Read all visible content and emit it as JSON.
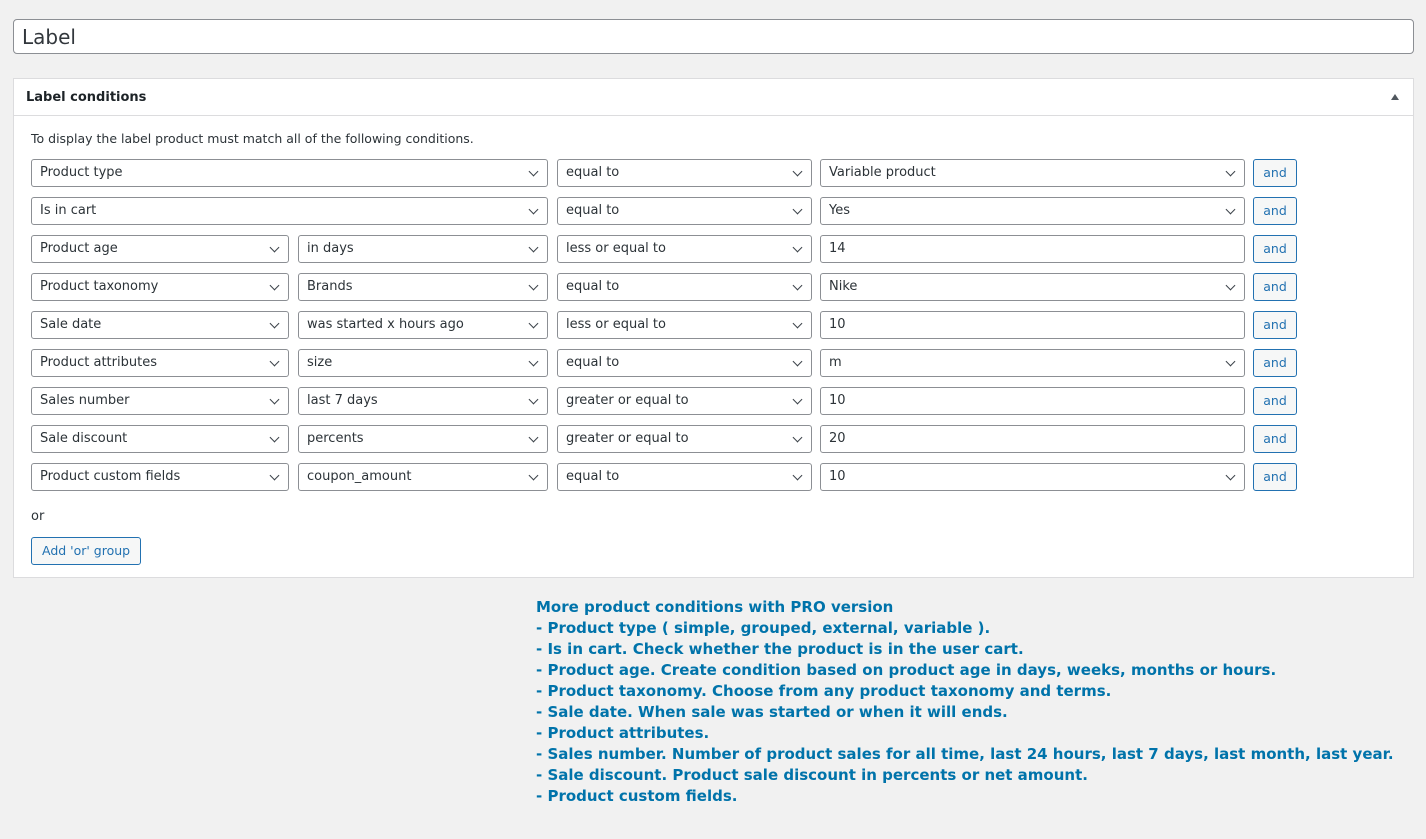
{
  "title_input": {
    "value": "Label"
  },
  "panel": {
    "title": "Label conditions",
    "description": "To display the label product must match all of the following conditions."
  },
  "rules": [
    {
      "condition": "Product type",
      "sub": null,
      "operator": "equal to",
      "value": "Variable product",
      "value_is_select": true,
      "and_label": "and"
    },
    {
      "condition": "Is in cart",
      "sub": null,
      "operator": "equal to",
      "value": "Yes",
      "value_is_select": true,
      "and_label": "and"
    },
    {
      "condition": "Product age",
      "sub": "in days",
      "operator": "less or equal to",
      "value": "14",
      "value_is_select": false,
      "and_label": "and"
    },
    {
      "condition": "Product taxonomy",
      "sub": "Brands",
      "operator": "equal to",
      "value": "Nike",
      "value_is_select": true,
      "and_label": "and"
    },
    {
      "condition": "Sale date",
      "sub": "was started x hours ago",
      "operator": "less or equal to",
      "value": "10",
      "value_is_select": false,
      "and_label": "and"
    },
    {
      "condition": "Product attributes",
      "sub": "size",
      "operator": "equal to",
      "value": "m",
      "value_is_select": true,
      "and_label": "and"
    },
    {
      "condition": "Sales number",
      "sub": "last 7 days",
      "operator": "greater or equal to",
      "value": "10",
      "value_is_select": false,
      "and_label": "and"
    },
    {
      "condition": "Sale discount",
      "sub": "percents",
      "operator": "greater or equal to",
      "value": "20",
      "value_is_select": false,
      "and_label": "and"
    },
    {
      "condition": "Product custom fields",
      "sub": "coupon_amount",
      "operator": "equal to",
      "value": "10",
      "value_is_select": true,
      "and_label": "and"
    }
  ],
  "or_label": "or",
  "add_or_button": "Add 'or' group",
  "pro_info": {
    "heading": "More product conditions with PRO version",
    "lines": [
      "- Product type ( simple, grouped, external, variable  ).",
      "- Is in cart. Check whether the product is in the user cart.",
      "- Product age. Create condition based on product age in days, weeks, months or hours.",
      "- Product taxonomy. Choose from any product taxonomy and terms.",
      "- Sale date. When sale was started or when it will ends.",
      "- Product attributes.",
      "- Sales number. Number of product sales for all time, last 24 hours, last 7 days, last month, last year.",
      "- Sale discount. Product sale discount in percents or net amount.",
      "- Product custom fields."
    ]
  },
  "colors": {
    "accent": "#2271b1",
    "pro_text": "#0073aa",
    "background": "#f1f1f1"
  }
}
